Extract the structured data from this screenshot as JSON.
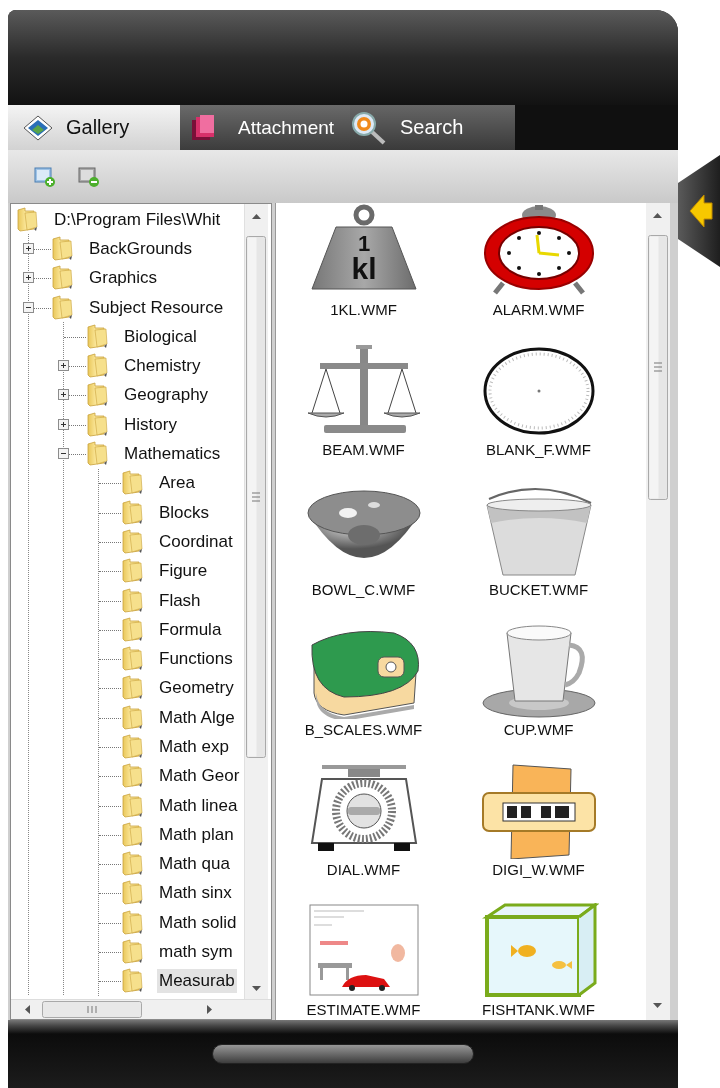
{
  "tabs": [
    {
      "label": "Gallery",
      "selected": true,
      "kind": "gallery"
    },
    {
      "label": "Attachment",
      "selected": false,
      "kind": "attachment"
    },
    {
      "label": "Search",
      "selected": false,
      "kind": "search"
    }
  ],
  "tree": {
    "root": {
      "label": "D:\\Program Files\\Whit",
      "selected": false,
      "children": [
        {
          "label": "BackGrounds",
          "expanded": false,
          "selected": false
        },
        {
          "label": "Graphics",
          "expanded": false,
          "selected": false
        },
        {
          "label": "Subject Resource",
          "expanded": true,
          "selected": false,
          "children": [
            {
              "label": "Biological",
              "selected": false
            },
            {
              "label": "Chemistry",
              "expanded": false,
              "selected": false
            },
            {
              "label": "Geography",
              "expanded": false,
              "selected": false
            },
            {
              "label": "History",
              "expanded": false,
              "selected": false
            },
            {
              "label": "Mathematics",
              "expanded": true,
              "selected": false,
              "children": [
                {
                  "label": "Area",
                  "selected": false
                },
                {
                  "label": "Blocks",
                  "selected": false
                },
                {
                  "label": "Coordinat",
                  "selected": false
                },
                {
                  "label": "Figure",
                  "selected": false
                },
                {
                  "label": "Flash",
                  "selected": false
                },
                {
                  "label": "Formula",
                  "selected": false
                },
                {
                  "label": "Functions",
                  "selected": false
                },
                {
                  "label": "Geometry",
                  "selected": false
                },
                {
                  "label": "Math Alge",
                  "selected": false
                },
                {
                  "label": "Math exp",
                  "selected": false
                },
                {
                  "label": "Math Geor",
                  "selected": false
                },
                {
                  "label": "Math linea",
                  "selected": false
                },
                {
                  "label": "Math plan",
                  "selected": false
                },
                {
                  "label": "Math qua",
                  "selected": false
                },
                {
                  "label": "Math sinx",
                  "selected": false
                },
                {
                  "label": "Math solid",
                  "selected": false
                },
                {
                  "label": "math sym",
                  "selected": false
                },
                {
                  "label": "Measurab",
                  "selected": true
                }
              ]
            }
          ]
        }
      ]
    }
  },
  "gallery": {
    "items": [
      {
        "label": "1KL.WMF",
        "marking": [
          "1",
          "kl"
        ]
      },
      {
        "label": "ALARM.WMF"
      },
      {
        "label": "BEAM.WMF"
      },
      {
        "label": "BLANK_F.WMF"
      },
      {
        "label": "BOWL_C.WMF"
      },
      {
        "label": "BUCKET.WMF"
      },
      {
        "label": "B_SCALES.WMF"
      },
      {
        "label": "CUP.WMF"
      },
      {
        "label": "DIAL.WMF"
      },
      {
        "label": "DIGI_W.WMF"
      },
      {
        "label": "ESTIMATE.WMF"
      },
      {
        "label": "FISHTANK.WMF"
      }
    ]
  }
}
